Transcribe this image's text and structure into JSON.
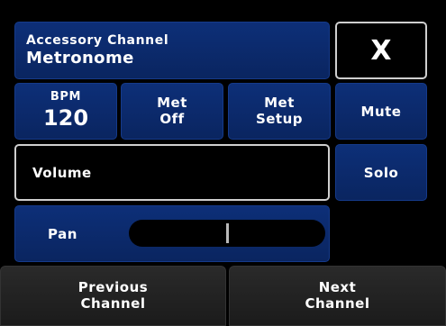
{
  "header": {
    "subtitle": "Accessory Channel",
    "title": "Metronome"
  },
  "close": {
    "label": "X"
  },
  "bpm": {
    "label": "BPM",
    "value": "120"
  },
  "met_off": {
    "line1": "Met",
    "line2": "Off"
  },
  "met_setup": {
    "line1": "Met",
    "line2": "Setup"
  },
  "mute": {
    "label": "Mute"
  },
  "volume": {
    "label": "Volume"
  },
  "solo": {
    "label": "Solo"
  },
  "pan": {
    "label": "Pan",
    "level": 0.5
  },
  "navigation": {
    "previous": {
      "line1": "Previous",
      "line2": "Channel"
    },
    "next": {
      "line1": "Next",
      "line2": "Channel"
    }
  },
  "colors": {
    "button_blue": "#0d2f78",
    "button_dark": "#222222",
    "outline": "#cfcfcf",
    "background": "#000000"
  }
}
